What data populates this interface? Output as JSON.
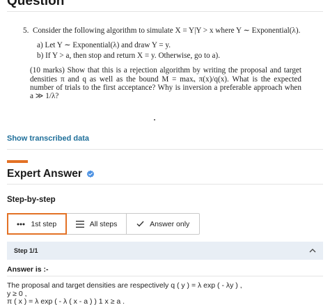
{
  "page": {
    "heading": "Question"
  },
  "question": {
    "number": "5.",
    "stem": "Consider the following algorithm to simulate X = Y|Y > x where Y ∼ Exponential(λ).",
    "steps": [
      "a)  Let Y ∼ Exponential(λ) and draw Y = y.",
      "b)  If Y > a, then stop and return X = y. Otherwise, go to a)."
    ],
    "paragraph": "(10 marks) Show that this is a rejection algorithm by writing the proposal and target densities π and q as well as the bound M = maxₓ π(x)/q(x). What is the expected number of trials to the first acceptance? Why is inversion a preferable approach when a ≫ 1/λ?"
  },
  "links": {
    "show_transcribed": "Show transcribed data"
  },
  "expert": {
    "title": "Expert Answer"
  },
  "step_by_step": {
    "label": "Step-by-step"
  },
  "tabs": [
    {
      "label": "1st step",
      "active": true
    },
    {
      "label": "All steps",
      "active": false
    },
    {
      "label": "Answer only",
      "active": false
    }
  ],
  "step_header": {
    "label": "Step 1/1"
  },
  "answer": {
    "heading": "Answer is :-",
    "lines": [
      "The proposal and target densities are respectively q ( y ) = λ exp ( - λy ) ,",
      "y ≥ 0 ,",
      "π ( x ) = λ exp ( - λ ( x - a ) ) 1 x ≥ a ."
    ]
  },
  "colors": {
    "accent": "#e37125",
    "link": "#1f6f9a",
    "verified": "#4a90e2",
    "step_header_bg": "#e8eef5"
  }
}
